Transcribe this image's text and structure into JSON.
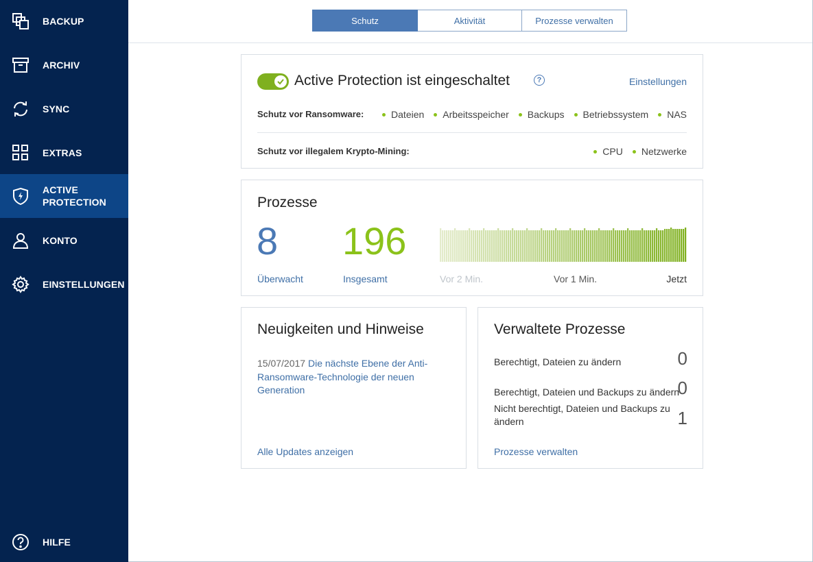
{
  "sidebar": {
    "items": [
      {
        "label": "BACKUP",
        "icon": "backup-icon"
      },
      {
        "label": "ARCHIV",
        "icon": "archive-icon"
      },
      {
        "label": "SYNC",
        "icon": "sync-icon"
      },
      {
        "label": "EXTRAS",
        "icon": "extras-icon"
      },
      {
        "label": "ACTIVE PROTECTION",
        "icon": "shield-icon",
        "active": true
      },
      {
        "label": "KONTO",
        "icon": "account-icon"
      },
      {
        "label": "EINSTELLUNGEN",
        "icon": "gear-icon"
      }
    ],
    "help_label": "HILFE"
  },
  "tabs": [
    {
      "label": "Schutz",
      "active": true
    },
    {
      "label": "Aktivität",
      "active": false
    },
    {
      "label": "Prozesse verwalten",
      "active": false
    }
  ],
  "protection": {
    "title": "Active Protection ist eingeschaltet",
    "enabled": true,
    "settings_link": "Einstellungen",
    "ransomware_label": "Schutz vor Ransomware:",
    "ransomware_items": [
      "Dateien",
      "Arbeitsspeicher",
      "Backups",
      "Betriebssystem",
      "NAS"
    ],
    "crypto_label": "Schutz vor illegalem Krypto-Mining:",
    "crypto_items": [
      "CPU",
      "Netzwerke"
    ]
  },
  "processes": {
    "title": "Prozesse",
    "monitored_value": "8",
    "monitored_label": "Überwacht",
    "total_value": "196",
    "total_label": "Insgesamt",
    "timeline_labels": [
      "Vor 2 Min.",
      "Vor 1 Min.",
      "Jetzt"
    ]
  },
  "news": {
    "title": "Neuigkeiten und Hinweise",
    "date": "15/07/2017",
    "headline": "Die nächste Ebene der Anti-Ransomware-Technologie der neuen Generation",
    "all_updates_link": "Alle Updates anzeigen"
  },
  "managed": {
    "title": "Verwaltete Prozesse",
    "rows": [
      {
        "label": "Berechtigt, Dateien zu ändern",
        "value": "0"
      },
      {
        "label": "Berechtigt, Dateien und Backups zu ändern",
        "value": "0"
      },
      {
        "label": "Nicht berechtigt, Dateien und Backups zu ändern",
        "value": "1"
      }
    ],
    "manage_link": "Prozesse verwalten"
  },
  "colors": {
    "sidebar_bg": "#04234f",
    "sidebar_active": "#0d4587",
    "accent_blue": "#4b79b5",
    "accent_green": "#7fb01f"
  }
}
